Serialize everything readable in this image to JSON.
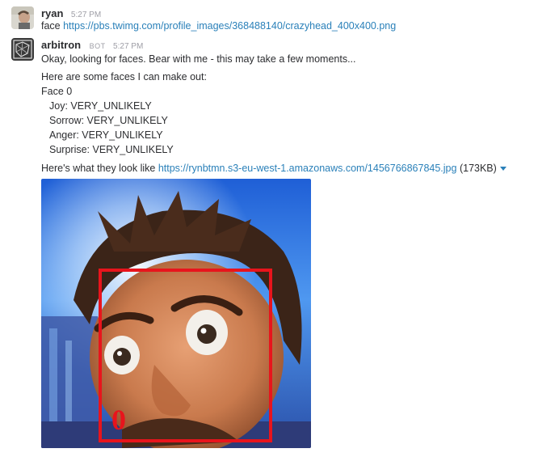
{
  "messages": [
    {
      "sender": "ryan",
      "time": "5:27 PM",
      "text_prefix": "face ",
      "link": "https://pbs.twimg.com/profile_images/368488140/crazyhead_400x400.png"
    },
    {
      "sender": "arbitron",
      "bot_tag": "BOT",
      "time": "5:27 PM",
      "line1": "Okay, looking for faces. Bear with me - this may take a few moments...",
      "line2": "Here are some faces I can make out:",
      "face_title": "Face 0",
      "joy": "Joy: VERY_UNLIKELY",
      "sorrow": "Sorrow: VERY_UNLIKELY",
      "anger": "Anger: VERY_UNLIKELY",
      "surprise": "Surprise: VERY_UNLIKELY",
      "look_prefix": "Here's what they look like ",
      "image_link": "https://rynbtmn.s3-eu-west-1.amazonaws.com/1456766867845.jpg",
      "image_size": "(173KB)",
      "face_label": "0"
    }
  ],
  "colors": {
    "link": "#2a80b9",
    "face_box": "#e8141c",
    "muted": "#9e9ea6"
  },
  "icons": {
    "ryan_avatar": "user-avatar-icon",
    "bot_avatar": "bot-avatar-icon",
    "dropdown": "chevron-down-icon"
  }
}
